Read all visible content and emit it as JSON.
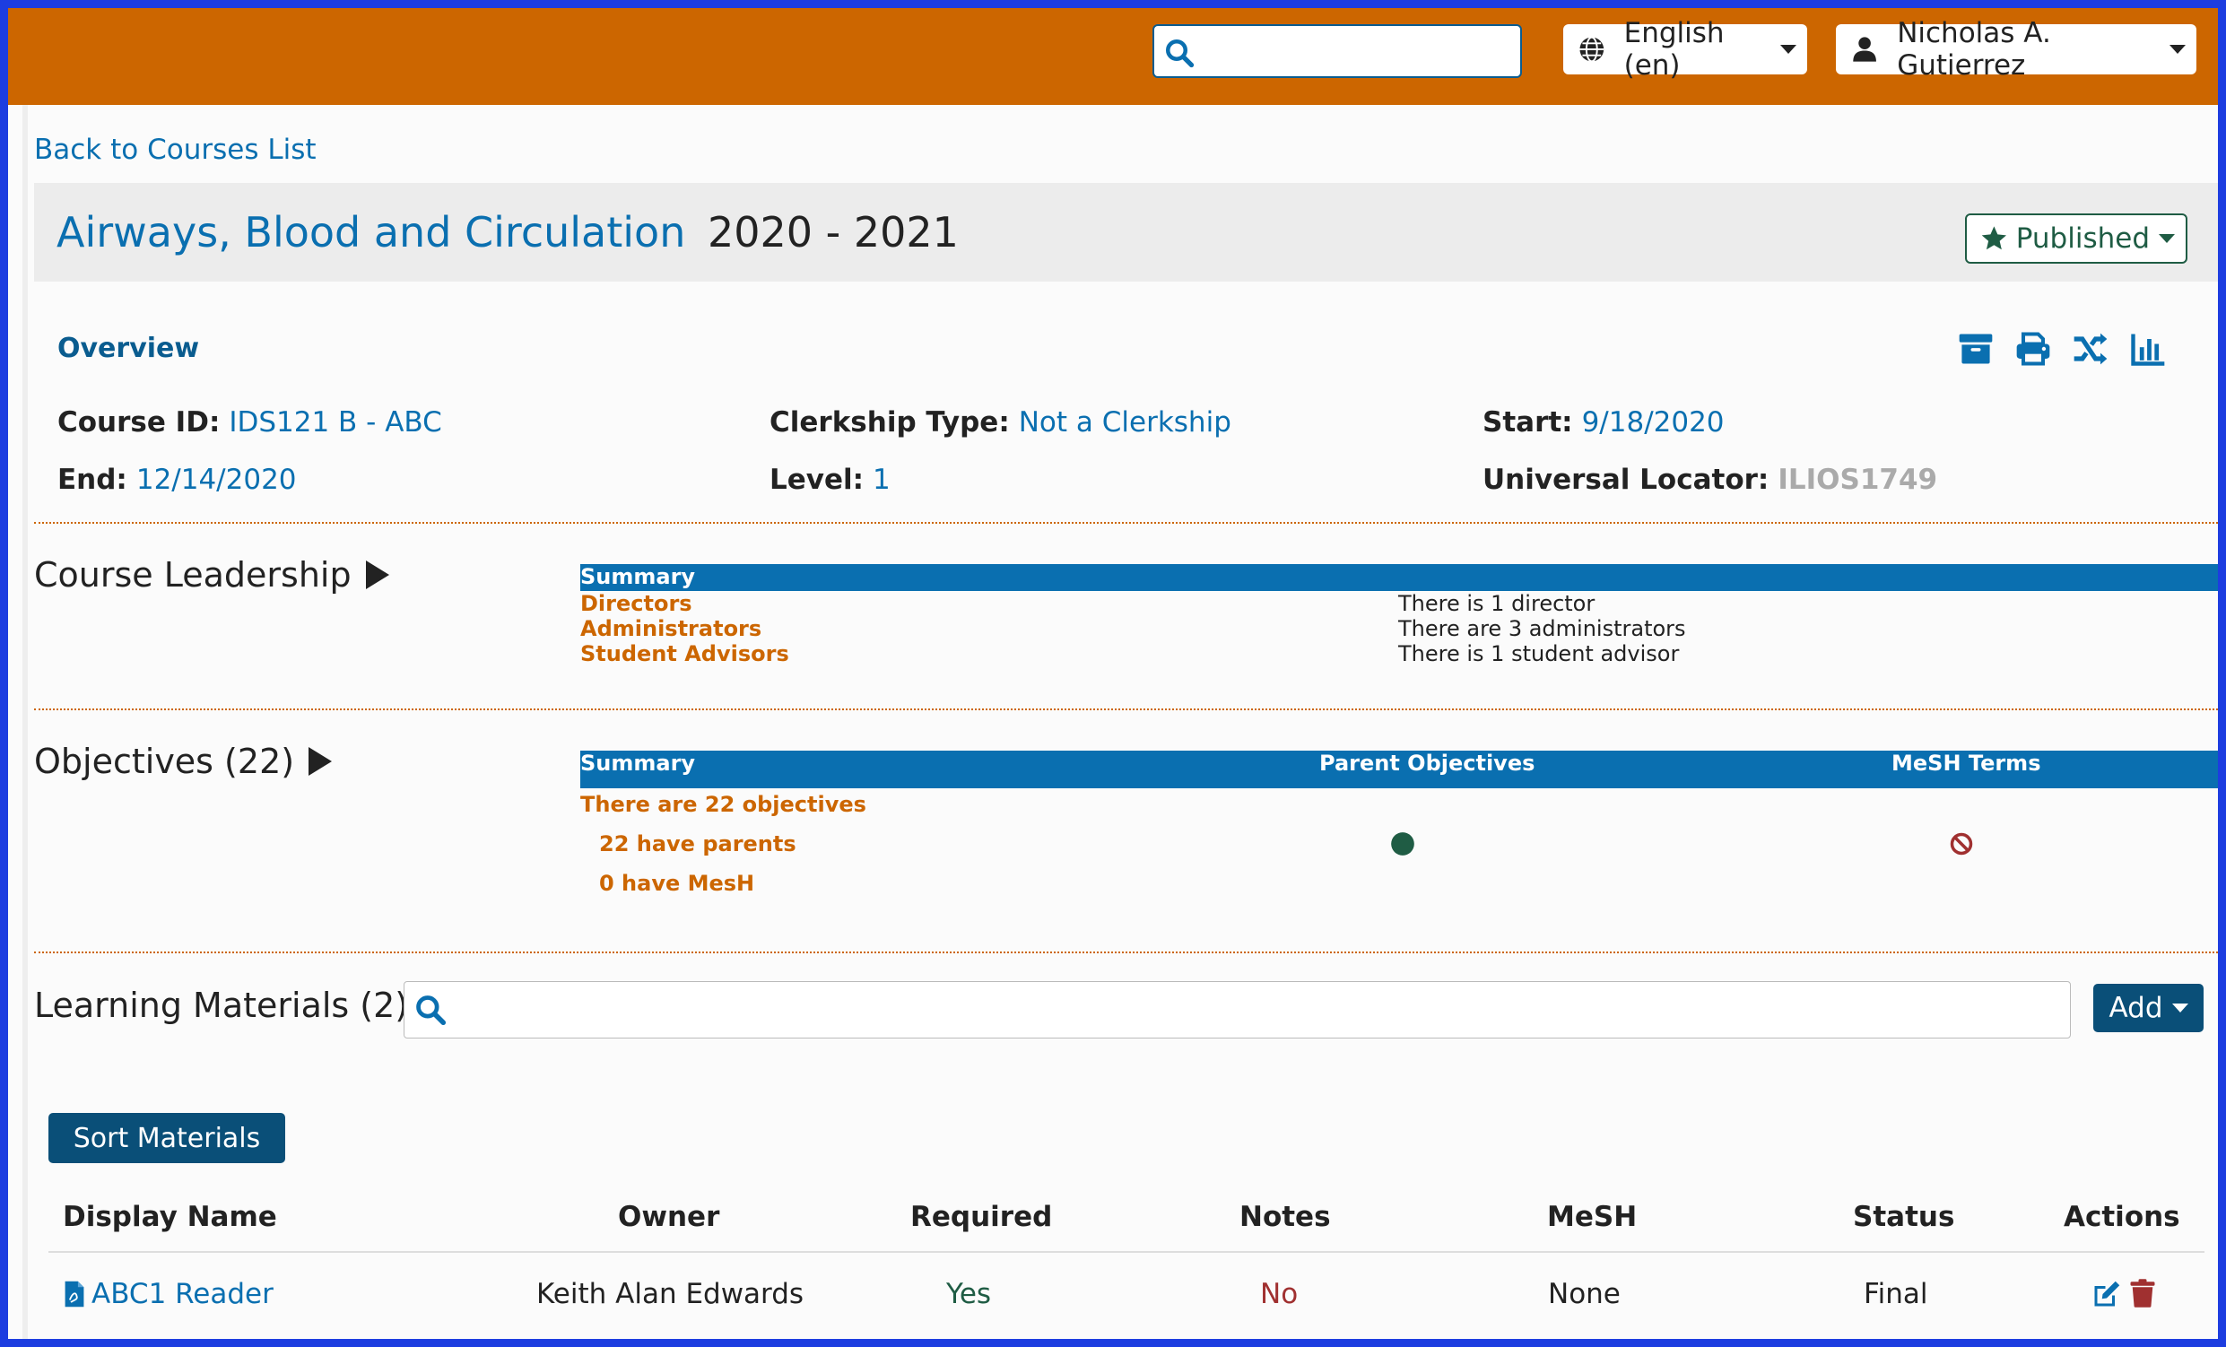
{
  "header": {
    "search": {
      "placeholder": "",
      "value": ""
    },
    "language": "English (en)",
    "user": "Nicholas A. Gutierrez"
  },
  "nav": {
    "back_link": "Back to Courses List"
  },
  "course": {
    "name": "Airways, Blood and Circulation",
    "year": "2020 - 2021",
    "publish_status": "Published"
  },
  "overview": {
    "heading": "Overview",
    "fields": {
      "course_id": {
        "label": "Course ID:",
        "value": "IDS121 B - ABC"
      },
      "clerkship_type": {
        "label": "Clerkship Type:",
        "value": "Not a Clerkship"
      },
      "start": {
        "label": "Start:",
        "value": "9/18/2020"
      },
      "end": {
        "label": "End:",
        "value": "12/14/2020"
      },
      "level": {
        "label": "Level:",
        "value": "1"
      },
      "locator": {
        "label": "Universal Locator:",
        "value": "ILIOS1749"
      }
    },
    "tool_icons": [
      "archive-icon",
      "print-icon",
      "shuffle-icon",
      "chart-icon"
    ]
  },
  "leadership": {
    "title": "Course Leadership",
    "summary_header": "Summary",
    "rows": [
      {
        "label": "Directors",
        "text": "There is 1 director"
      },
      {
        "label": "Administrators",
        "text": "There are 3 administrators"
      },
      {
        "label": "Student Advisors",
        "text": "There is 1 student advisor"
      }
    ]
  },
  "objectives": {
    "title": "Objectives (22)",
    "headers": {
      "summary": "Summary",
      "parents": "Parent Objectives",
      "mesh": "MeSH Terms"
    },
    "total": "There are 22 objectives",
    "have_parents": "22 have parents",
    "have_mesh": "0 have MesH",
    "parents_status": "complete",
    "mesh_status": "none"
  },
  "learning_materials": {
    "title": "Learning Materials (2)",
    "search_placeholder": "",
    "add_label": "Add",
    "sort_label": "Sort Materials",
    "columns": [
      "Display Name",
      "Owner",
      "Required",
      "Notes",
      "MeSH",
      "Status",
      "Actions"
    ],
    "rows": [
      {
        "display_name": "ABC1 Reader",
        "owner": "Keith Alan Edwards",
        "required": "Yes",
        "notes": "No",
        "mesh": "None",
        "status": "Final"
      }
    ]
  },
  "colors": {
    "header_orange": "#cc6600",
    "link_blue": "#0a6fb0",
    "table_head_blue": "#0a6fb0",
    "button_navy": "#0a4f78",
    "success_green": "#1f5c44",
    "danger_red": "#a03030",
    "frame_blue": "#1d3de0"
  }
}
